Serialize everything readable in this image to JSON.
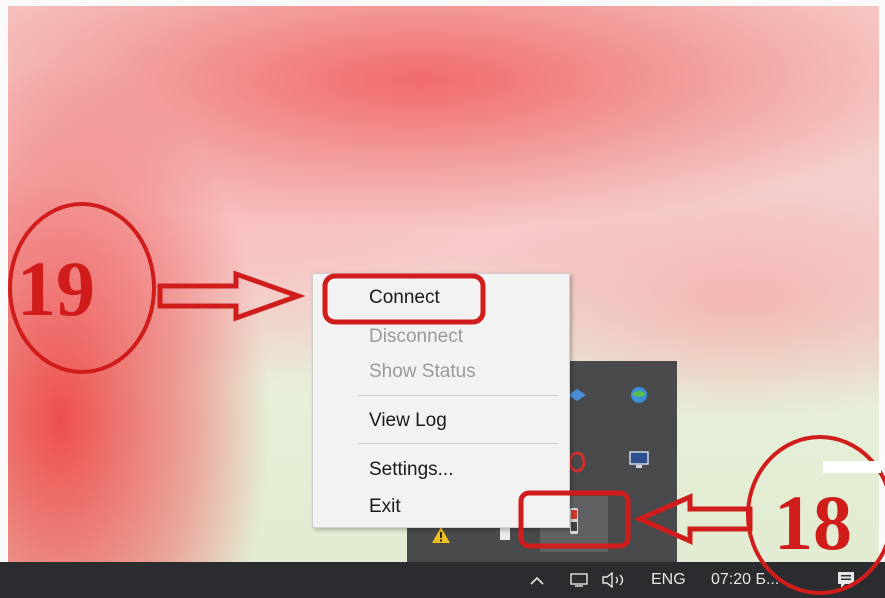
{
  "context_menu": {
    "items": [
      {
        "label": "Connect",
        "enabled": true
      },
      {
        "label": "Disconnect",
        "enabled": false
      },
      {
        "label": "Show Status",
        "enabled": false
      },
      {
        "label": "View Log",
        "enabled": true
      },
      {
        "label": "Settings...",
        "enabled": true
      },
      {
        "label": "Exit",
        "enabled": true
      }
    ]
  },
  "tray_overflow": {
    "icons": [
      "bluetooth-icon",
      "network-globe-icon",
      "antivirus-icon",
      "display-monitor-icon",
      "warning-icon",
      "usb-drive-icon",
      "vpn-client-icon"
    ]
  },
  "taskbar": {
    "chevron_glyph": "^",
    "language": "ENG",
    "clock": "07:20 Б...",
    "icons": [
      "show-hidden-icons-chevron",
      "network-icon",
      "volume-icon",
      "action-center-icon"
    ]
  },
  "annotations": {
    "step_left": "19",
    "step_right": "18",
    "color": "#d11c1c"
  }
}
